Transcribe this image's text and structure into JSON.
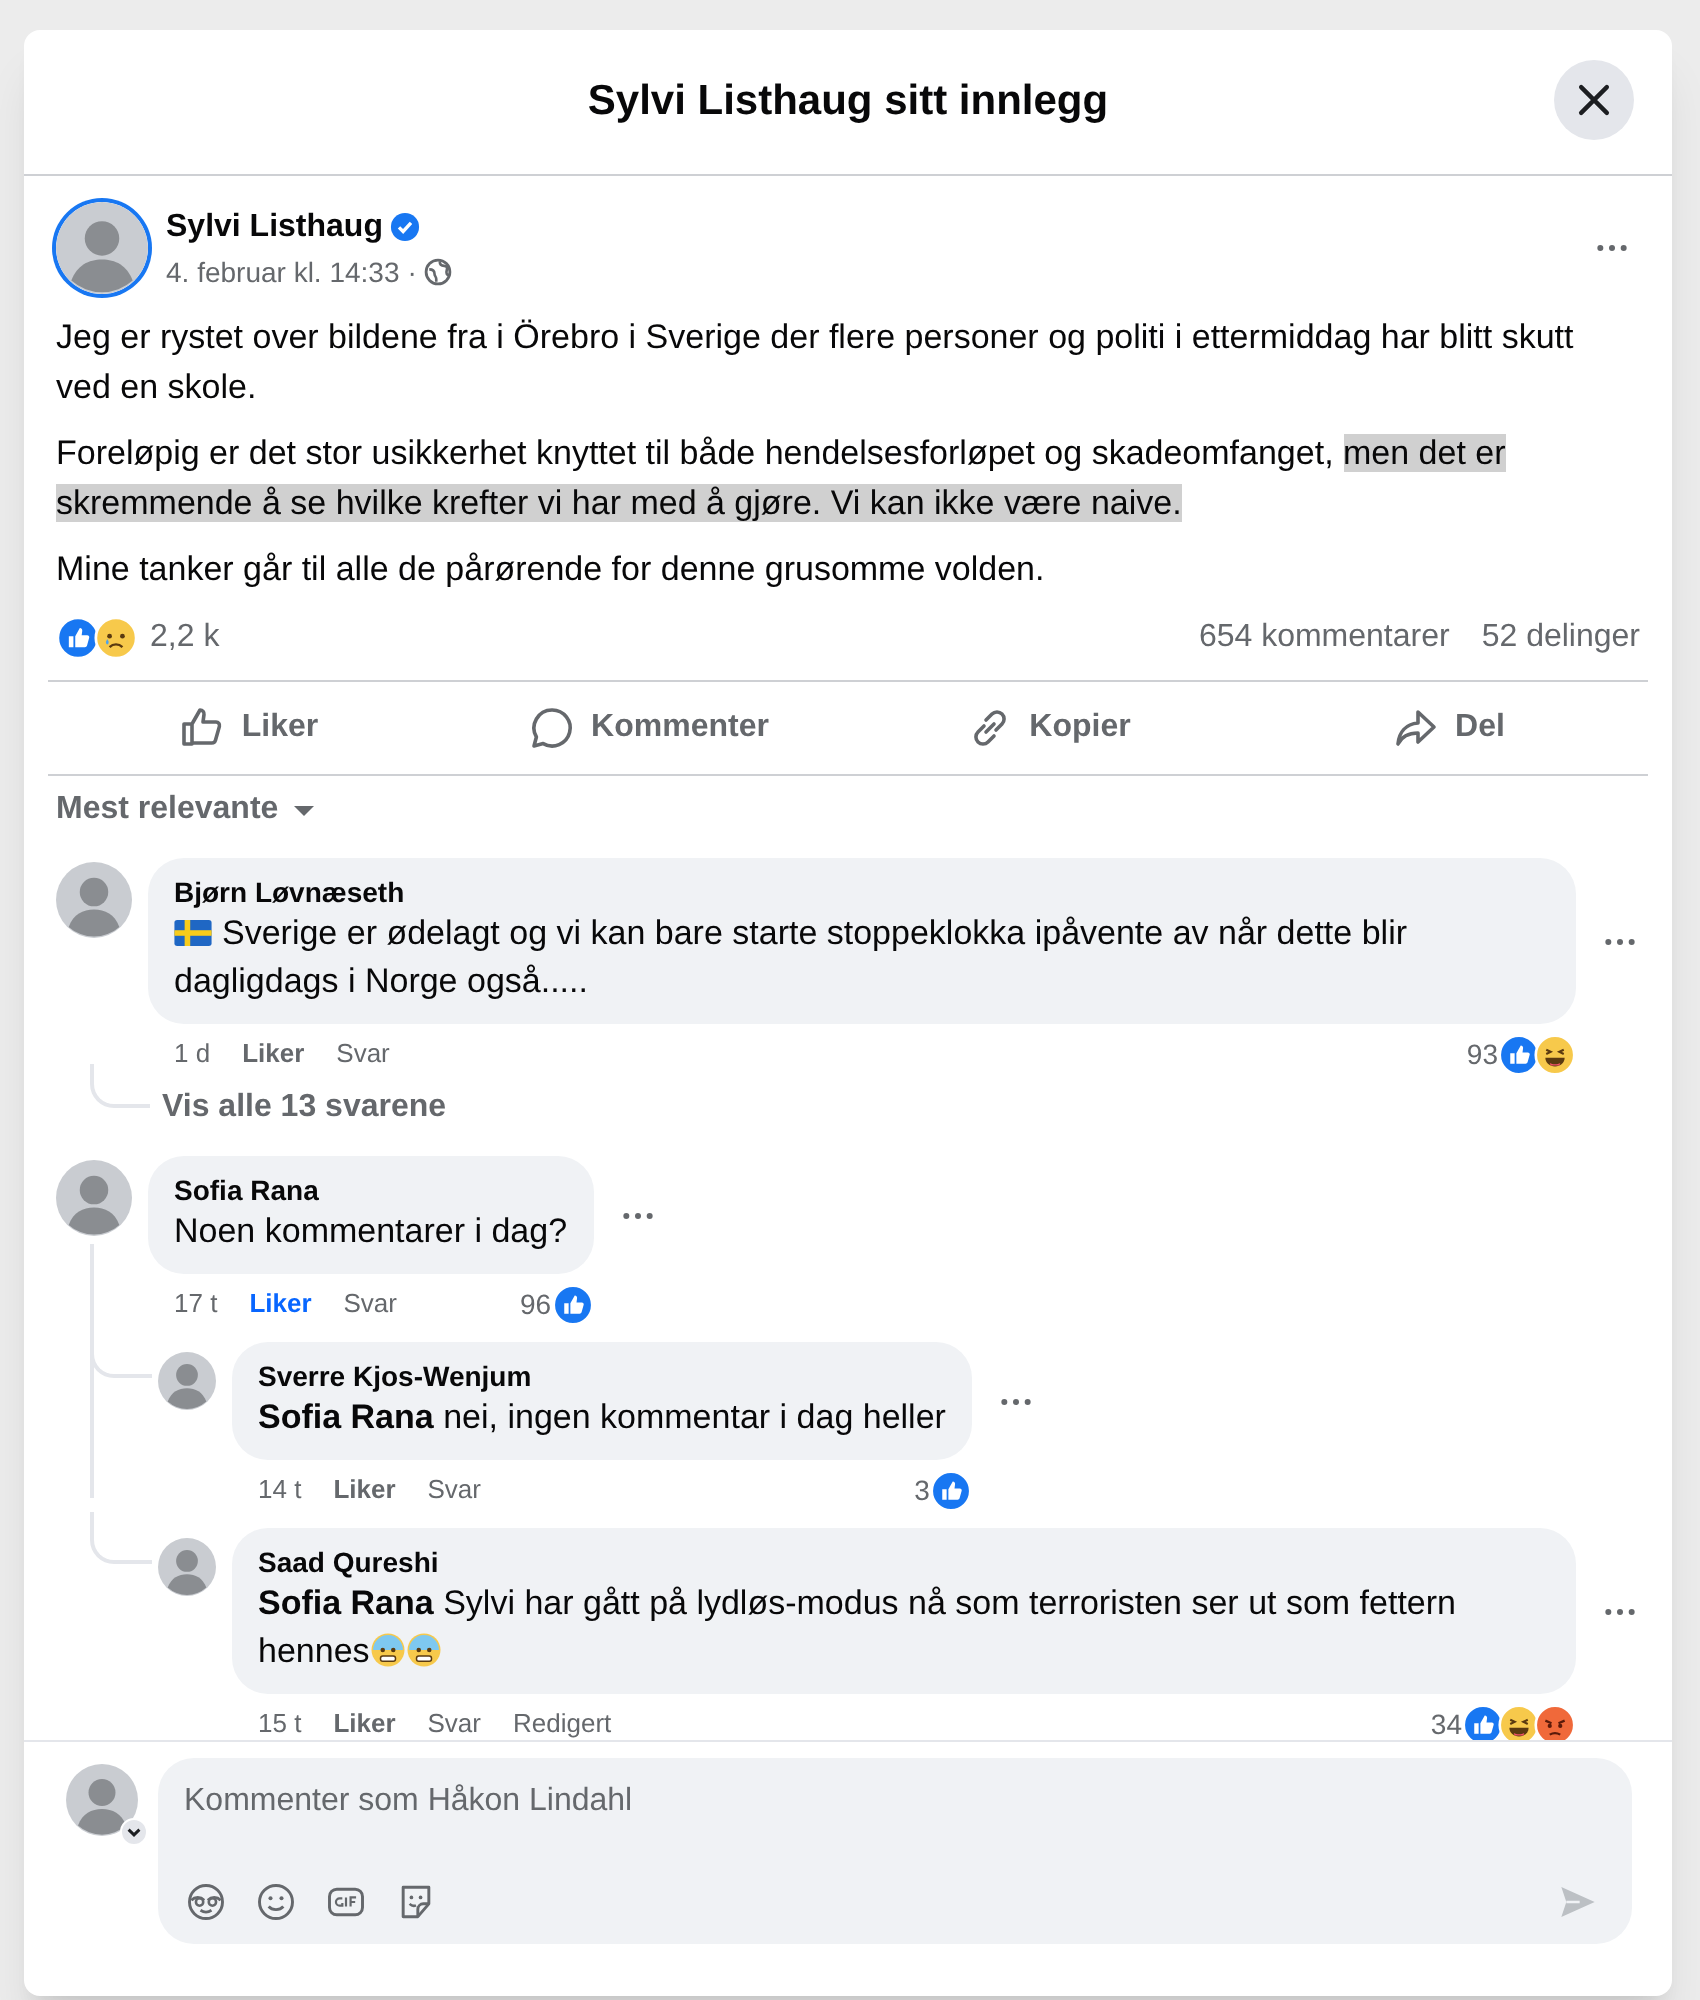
{
  "dialog": {
    "title": "Sylvi Listhaug sitt innlegg"
  },
  "post": {
    "author": "Sylvi Listhaug",
    "verified": true,
    "time": "4. februar kl. 14:33",
    "separator": "·",
    "paragraphs": [
      [
        {
          "text": "Jeg er rystet over bildene fra i Örebro i Sverige der flere personer og politi i ettermiddag har blitt skutt ved en skole.",
          "highlighted": false
        }
      ],
      [
        {
          "text": "Foreløpig er det stor usikkerhet knyttet til både hendelsesforløpet og skadeomfanget, ",
          "highlighted": false
        },
        {
          "text": "men det er skremmende å se hvilke krefter vi har med å gjøre. Vi kan ikke være naive.",
          "highlighted": true
        }
      ],
      [
        {
          "text": "Mine tanker går til alle de pårørende for denne grusomme volden.",
          "highlighted": false
        }
      ]
    ],
    "reactions": [
      {
        "kind": "like"
      },
      {
        "kind": "sad"
      }
    ],
    "reaction_count": "2,2 k",
    "comments_count": "654 kommentarer",
    "shares_count": "52 delinger"
  },
  "actions": [
    {
      "kind": "like",
      "label": "Liker"
    },
    {
      "kind": "comment",
      "label": "Kommenter"
    },
    {
      "kind": "link",
      "label": "Kopier"
    },
    {
      "kind": "share",
      "label": "Del"
    }
  ],
  "sort": {
    "label": "Mest relevante"
  },
  "comments": [
    {
      "author": "Bjørn Løvnæseth",
      "lead_emoji": [
        {
          "kind": "flag"
        }
      ],
      "text": "Sverige er ødelagt og vi kan bare starte stoppeklokka ipåvente av når dette blir dagligdags i Norge også.....",
      "time": "1 d",
      "like_label": "Liker",
      "liked": false,
      "reply_label": "Svar",
      "reaction_count": "93",
      "reactions": [
        {
          "kind": "like"
        },
        {
          "kind": "haha"
        }
      ],
      "view_replies": "Vis alle 13 svarene"
    },
    {
      "author": "Sofia Rana",
      "text": "Noen kommentarer i dag?",
      "time": "17 t",
      "like_label": "Liker",
      "liked": true,
      "reply_label": "Svar",
      "reaction_count": "96",
      "reactions": [
        {
          "kind": "like"
        }
      ],
      "children": [
        {
          "author": "Sverre Kjos-Wenjum",
          "text": "**Sofia Rana** nei, ingen kommentar i dag heller",
          "time": "14 t",
          "like_label": "Liker",
          "liked": false,
          "reply_label": "Svar",
          "reaction_count": "3",
          "reactions": [
            {
              "kind": "like"
            }
          ]
        },
        {
          "author": "Saad Qureshi",
          "text": "**Sofia Rana** Sylvi har gått på lydløs-modus nå som terroristen ser ut som fettern hennes",
          "trailing_emoji": [
            {
              "kind": "cold-sweat"
            },
            {
              "kind": "cold-sweat"
            }
          ],
          "time": "15 t",
          "like_label": "Liker",
          "liked": false,
          "reply_label": "Svar",
          "edited_label": "Redigert",
          "reaction_count": "34",
          "reactions": [
            {
              "kind": "like"
            },
            {
              "kind": "haha"
            },
            {
              "kind": "angry"
            }
          ]
        }
      ]
    }
  ],
  "composer": {
    "placeholder": "Kommenter som Håkon Lindahl",
    "tools": [
      {
        "kind": "avatar"
      },
      {
        "kind": "emoji"
      },
      {
        "kind": "gif"
      },
      {
        "kind": "sticker"
      }
    ]
  }
}
